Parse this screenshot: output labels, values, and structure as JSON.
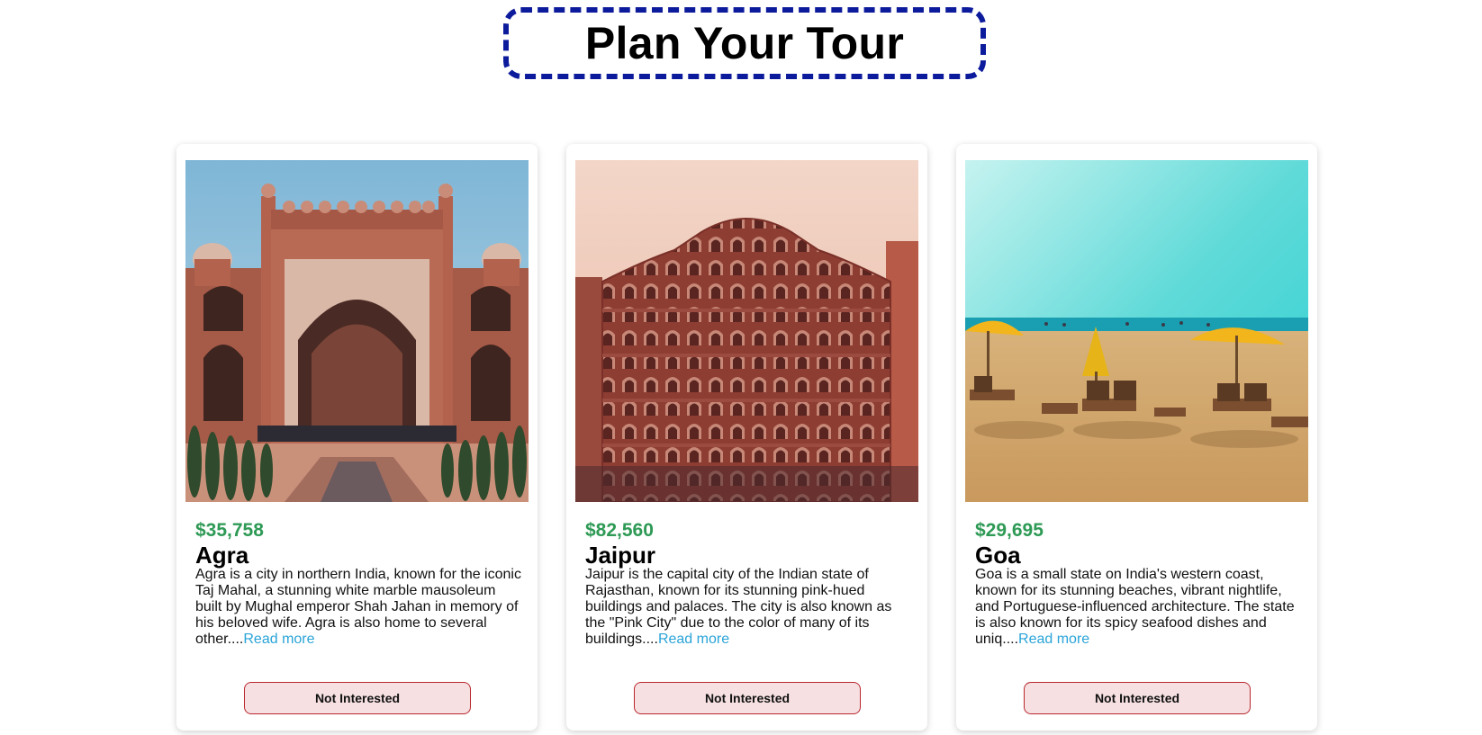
{
  "header": {
    "title": "Plan Your Tour"
  },
  "tours": [
    {
      "price": "$35,758",
      "name": "Agra",
      "description": "Agra is a city in northern India, known for the iconic Taj Mahal, a stunning white marble mausoleum built by Mughal emperor Shah Jahan in memory of his beloved wife. Agra is also home to several other....",
      "read_more": "Read more",
      "button": "Not Interested",
      "image_icon": "taj-mahal-gate-photo"
    },
    {
      "price": "$82,560",
      "name": "Jaipur",
      "description": "Jaipur is the capital city of the Indian state of Rajasthan, known for its stunning pink-hued buildings and palaces. The city is also known as the \"Pink City\" due to the color of many of its buildings....",
      "read_more": "Read more",
      "button": "Not Interested",
      "image_icon": "hawa-mahal-photo"
    },
    {
      "price": "$29,695",
      "name": "Goa",
      "description": "Goa is a small state on India's western coast, known for its stunning beaches, vibrant nightlife, and Portuguese-influenced architecture. The state is also known for its spicy seafood dishes and uniq....",
      "read_more": "Read more",
      "button": "Not Interested",
      "image_icon": "goa-beach-photo"
    }
  ],
  "colors": {
    "title_border": "#0c1a9c",
    "price": "#2e9a55",
    "link": "#2aa4d8",
    "button_bg": "#f6e0e2",
    "button_border": "#b8282e"
  }
}
